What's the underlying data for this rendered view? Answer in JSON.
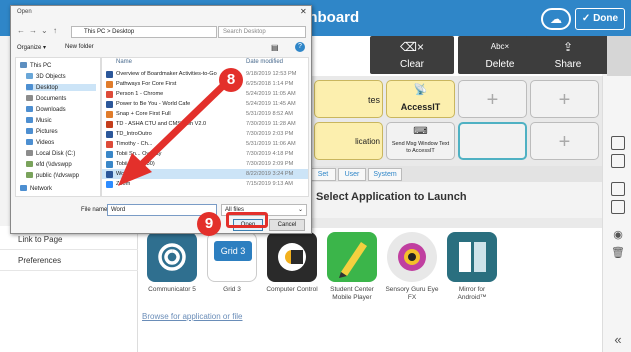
{
  "app": {
    "title": "shboard",
    "done_label": "Done",
    "cloud_icon": "cloud-sync-icon"
  },
  "action_bar": [
    {
      "label": "Clear",
      "icon": "clear-text-icon",
      "glyph": "⌫×"
    },
    {
      "label": "Delete",
      "icon": "delete-word-icon",
      "glyph": "Abc×"
    },
    {
      "label": "Share",
      "icon": "share-icon",
      "glyph": "⇪"
    }
  ],
  "grid": {
    "cell_partial_1": "tes",
    "cell_accessit": "AccessIT",
    "cell_partial_2": "lication",
    "cell_send_msg": "Send Msg Window Text to AccessIT"
  },
  "tabs": [
    "Set",
    "User",
    "System"
  ],
  "select_title": "Select Application to Launch",
  "left_panel": [
    "Link to Page",
    "Preferences"
  ],
  "apps": [
    {
      "name": "Communicator 5",
      "color": "#2f6f8f"
    },
    {
      "name": "Grid 3",
      "color": "#2d7fc0",
      "badge": "Grid 3"
    },
    {
      "name": "Computer Control",
      "color": "#2a2a2a"
    },
    {
      "name": "Student Center Mobile Player",
      "color": "#3bb54a"
    },
    {
      "name": "Sensory Guru Eye FX",
      "color": "#e8e8e8"
    },
    {
      "name": "Mirror for Android™",
      "color": "#2a6f7f"
    }
  ],
  "browse_link": "Browse for application or file",
  "dialog": {
    "title": "Open",
    "path": "This PC  >  Desktop",
    "search_placeholder": "Search Desktop",
    "organize": "Organize ▾",
    "new_folder": "New folder",
    "col_name": "Name",
    "col_date": "Date modified",
    "nav_items": [
      {
        "label": "This PC",
        "color": "#5d8fc0"
      },
      {
        "label": "3D Objects",
        "color": "#6aa7d8"
      },
      {
        "label": "Desktop",
        "color": "#4d8fd1",
        "selected": true
      },
      {
        "label": "Documents",
        "color": "#8c8c8c"
      },
      {
        "label": "Downloads",
        "color": "#4d8fd1"
      },
      {
        "label": "Music",
        "color": "#4d8fd1"
      },
      {
        "label": "Pictures",
        "color": "#4d8fd1"
      },
      {
        "label": "Videos",
        "color": "#4d8fd1"
      },
      {
        "label": "Local Disk (C:)",
        "color": "#8c8c8c"
      },
      {
        "label": "efd (\\\\dvswpp",
        "color": "#7aa35c"
      },
      {
        "label": "public (\\\\dvswpp",
        "color": "#7aa35c"
      },
      {
        "label": "Network",
        "color": "#4d8fd1"
      }
    ],
    "files": [
      {
        "name": "Overview of Boardmaker Activities-to-Go",
        "date": "9/18/2019 12:53 PM",
        "color": "#2b579a"
      },
      {
        "name": "Pathways For Core First",
        "date": "6/25/2018 1:14 PM",
        "color": "#e07c2b"
      },
      {
        "name": "Person 1 - Chrome",
        "date": "5/24/2019 11:05 AM",
        "color": "#dd4b39"
      },
      {
        "name": "Power to Be You - World Cafe",
        "date": "5/24/2019 11:45 AM",
        "color": "#2b579a"
      },
      {
        "name": "Snap + Core First Full",
        "date": "5/31/2019 8:52 AM",
        "color": "#e07c2b"
      },
      {
        "name": "TD - ASHA CTU and CMS...ion V2.0",
        "date": "7/30/2019 11:28 AM",
        "color": "#c43e1c"
      },
      {
        "name": "TD_IntroOutro",
        "date": "7/30/2019 2:03 PM",
        "color": "#2b579a"
      },
      {
        "name": "Timothy - Ch...",
        "date": "5/31/2019 11:06 AM",
        "color": "#dd4b39"
      },
      {
        "name": "Tobii Sn... Overlay",
        "date": "7/30/2019 4:18 PM",
        "color": "#3a87c8"
      },
      {
        "name": "Tobii_Dy...(380)",
        "date": "7/30/2019 2:09 PM",
        "color": "#3a87c8"
      },
      {
        "name": "Word",
        "date": "8/22/2019 3:24 PM",
        "color": "#2b579a",
        "highlight": true
      },
      {
        "name": "Zoom",
        "date": "7/15/2019 9:13 AM",
        "color": "#2d8cff"
      }
    ],
    "file_name_label": "File name:",
    "file_name_value": "Word",
    "file_type": "All files",
    "open_label": "Open",
    "cancel_label": "Cancel"
  },
  "annotations": {
    "step_8": "8",
    "step_9": "9",
    "accent": "#e3302b"
  }
}
